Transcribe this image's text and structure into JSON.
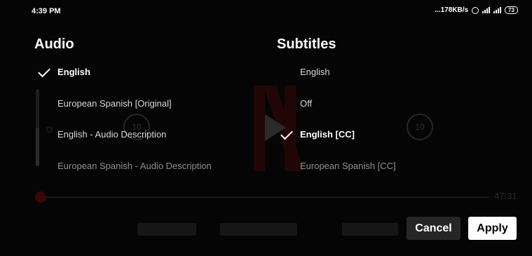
{
  "status_bar": {
    "time": "4:39 PM",
    "speed": "...178KB/s",
    "battery": "73",
    "icons": [
      "alarm-icon",
      "signal-icon",
      "signal-4g-icon",
      "battery-icon"
    ]
  },
  "audio": {
    "heading": "Audio",
    "options": [
      {
        "label": "English",
        "selected": true
      },
      {
        "label": "European Spanish [Original]",
        "selected": false
      },
      {
        "label": "English - Audio Description",
        "selected": false
      },
      {
        "label": "European Spanish - Audio Description",
        "selected": false
      }
    ]
  },
  "subtitles": {
    "heading": "Subtitles",
    "options": [
      {
        "label": "English",
        "selected": false
      },
      {
        "label": "Off",
        "selected": false
      },
      {
        "label": "English [CC]",
        "selected": true
      },
      {
        "label": "European Spanish [CC]",
        "selected": false
      }
    ]
  },
  "actions": {
    "cancel": "Cancel",
    "apply": "Apply"
  },
  "player": {
    "remaining_time": "47:31",
    "accent": "#e50914"
  }
}
